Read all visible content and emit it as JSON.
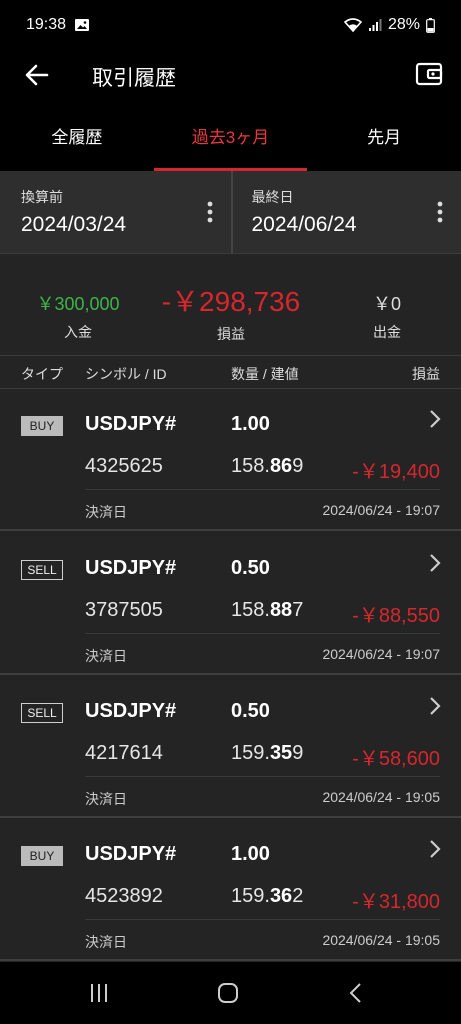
{
  "status": {
    "time": "19:38",
    "battery": "28%"
  },
  "header": {
    "title": "取引履歴"
  },
  "tabs": [
    {
      "label": "全履歴",
      "active": false
    },
    {
      "label": "過去3ヶ月",
      "active": true
    },
    {
      "label": "先月",
      "active": false
    }
  ],
  "date_range": {
    "start_label": "換算前",
    "start_value": "2024/03/24",
    "end_label": "最終日",
    "end_value": "2024/06/24"
  },
  "summary": {
    "deposit_amount": "￥300,000",
    "deposit_label": "入金",
    "pl_amount": "-￥298,736",
    "pl_label": "損益",
    "withdraw_amount": "￥0",
    "withdraw_label": "出金"
  },
  "columns": {
    "type": "タイプ",
    "symbol": "シンボル / ID",
    "qty": "数量 / 建値",
    "pl": "損益"
  },
  "trades": [
    {
      "type": "BUY",
      "symbol": "USDJPY#",
      "qty": "1.00",
      "id": "4325625",
      "price_a": "158.",
      "price_b": "86",
      "price_c": "9",
      "pl": "-￥19,400",
      "settle_label": "決済日",
      "settle_time": "2024/06/24 - 19:07"
    },
    {
      "type": "SELL",
      "symbol": "USDJPY#",
      "qty": "0.50",
      "id": "3787505",
      "price_a": "158.",
      "price_b": "88",
      "price_c": "7",
      "pl": "-￥88,550",
      "settle_label": "決済日",
      "settle_time": "2024/06/24 - 19:07"
    },
    {
      "type": "SELL",
      "symbol": "USDJPY#",
      "qty": "0.50",
      "id": "4217614",
      "price_a": "159.",
      "price_b": "35",
      "price_c": "9",
      "pl": "-￥58,600",
      "settle_label": "決済日",
      "settle_time": "2024/06/24 - 19:05"
    },
    {
      "type": "BUY",
      "symbol": "USDJPY#",
      "qty": "1.00",
      "id": "4523892",
      "price_a": "159.",
      "price_b": "36",
      "price_c": "2",
      "pl": "-￥31,800",
      "settle_label": "決済日",
      "settle_time": "2024/06/24 - 19:05"
    }
  ],
  "colors": {
    "accent": "#d7262d",
    "positive": "#3cb54a",
    "background": "#242424"
  }
}
